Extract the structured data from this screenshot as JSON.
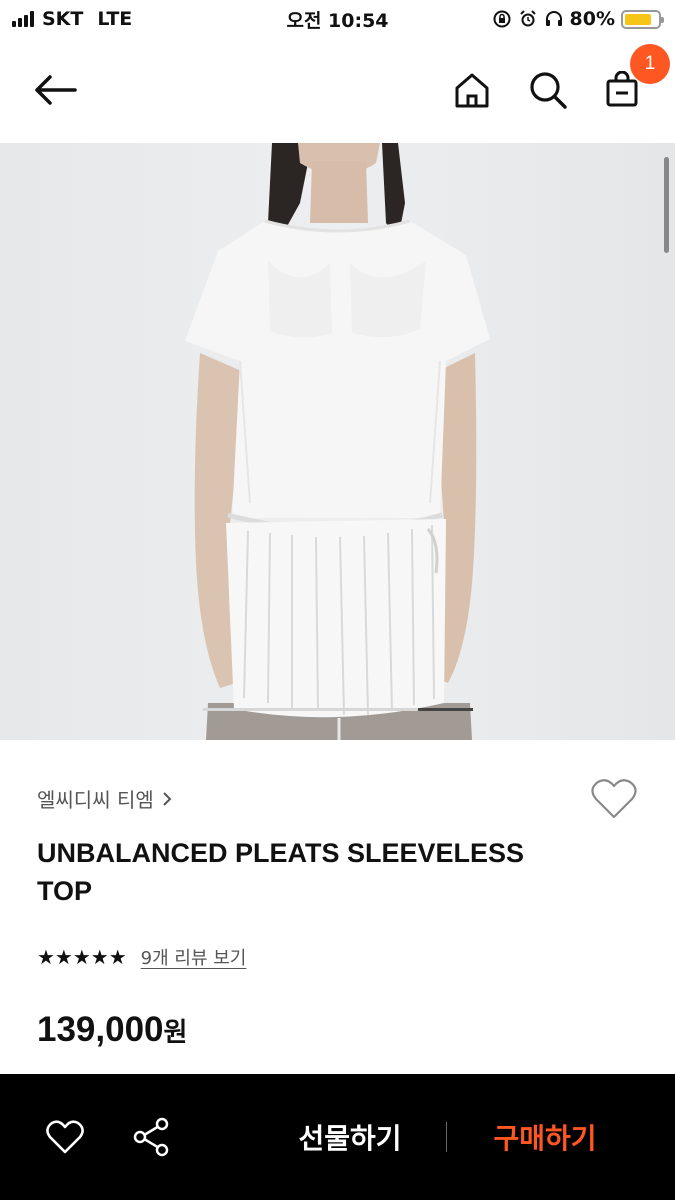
{
  "status_bar": {
    "carrier": "SKT",
    "network": "LTE",
    "time": "오전 10:54",
    "battery_percent": "80%",
    "battery_level": 0.8,
    "battery_color": "#f5c518"
  },
  "header": {
    "cart_count": "1",
    "icons": [
      "back-arrow-icon",
      "home-icon",
      "search-icon",
      "cart-icon"
    ],
    "badge_color": "#ff5722"
  },
  "gallery": {
    "image_description": "model wearing white pleated top",
    "indicator_active": "last"
  },
  "product": {
    "brand": "엘씨디씨 티엠",
    "name_line1": "UNBALANCED PLEATS SLEEVELESS",
    "name_line2": "TOP",
    "stars": "★★★★★",
    "rating": 5,
    "review_link": "9개 리뷰 보기",
    "price": "139,000",
    "currency": "원"
  },
  "bottom_bar": {
    "gift_label": "선물하기",
    "buy_label": "구매하기",
    "accent_color": "#ff5722"
  }
}
